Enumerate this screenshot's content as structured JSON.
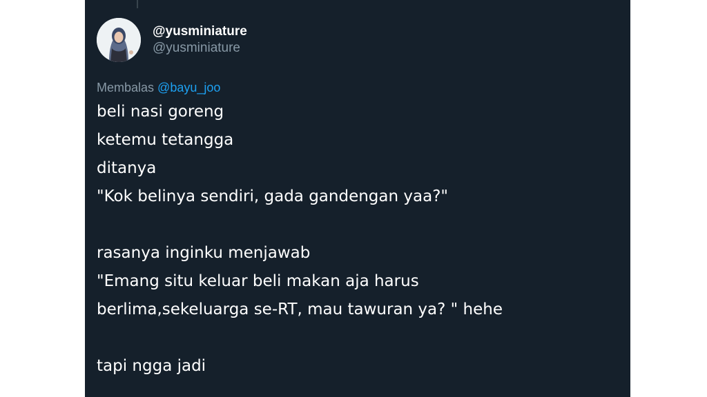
{
  "tweet": {
    "display_name": "@yusminiature",
    "handle": "@yusminiature",
    "avatar_icon": "profile-photo-avatar",
    "reply": {
      "prefix": "Membalas",
      "mention": "@bayu_joo"
    },
    "lines": [
      "beli nasi goreng",
      "ketemu tetangga",
      "ditanya",
      "\"Kok belinya sendiri, gada gandengan yaa?\"",
      "",
      "rasanya inginku menjawab",
      "\"Emang situ keluar beli makan aja harus",
      "berlima,sekeluarga se-RT, mau tawuran ya? \" hehe",
      "",
      "tapi ngga jadi"
    ]
  },
  "colors": {
    "card_background": "#15202b",
    "page_background": "#ffffff",
    "primary_text": "#ffffff",
    "secondary_text": "#8899a6",
    "link": "#1da1f2"
  }
}
